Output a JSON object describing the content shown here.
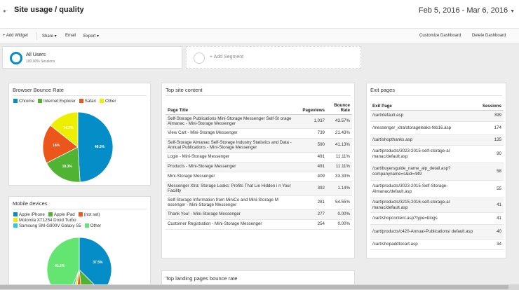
{
  "header": {
    "title": "Site usage / quality",
    "date_range": "Feb 5, 2016 - Mar 6, 2016"
  },
  "toolbar": {
    "add_widget": "+ Add Widget",
    "share": "Share ▾",
    "email": "Email",
    "export": "Export ▾",
    "customize": "Customize Dashboard",
    "delete": "Delete Dashboard"
  },
  "segments": {
    "active": {
      "name": "All Users",
      "sub": "100.00% Sessions"
    },
    "add_label": "+ Add Segment"
  },
  "colors": {
    "chrome": "#058dc7",
    "ie": "#50b432",
    "safari": "#ed561b",
    "other": "#edef00",
    "iphone": "#058dc7",
    "ipad": "#50b432",
    "notset": "#ed561b",
    "motorola": "#edef00",
    "samsung": "#24cbe5",
    "mobile_other": "#64e572"
  },
  "browser": {
    "title": "Browser Bounce Rate",
    "legend": [
      "Chrome",
      "Internet Explorer",
      "Safari",
      "Other"
    ]
  },
  "mobile": {
    "title": "Mobile devices",
    "legend": [
      "Apple iPhone",
      "Apple iPad",
      "(not set)",
      "Motorola XT1254 Droid Turbo",
      "Samsung SM-G900V Galaxy S5",
      "Other"
    ]
  },
  "chart_data": [
    {
      "type": "pie",
      "title": "Browser Bounce Rate",
      "categories": [
        "Chrome",
        "Internet Explorer",
        "Safari",
        "Other"
      ],
      "values": [
        48.5,
        18.3,
        18.0,
        14.2
      ],
      "labels": [
        "48.5%",
        "18.3%",
        "18%",
        "14.2%"
      ]
    },
    {
      "type": "pie",
      "title": "Mobile devices",
      "categories": [
        "Apple iPhone",
        "Apple iPad",
        "(not set)",
        "Motorola XT1254 Droid Turbo",
        "Samsung SM-G900V Galaxy S5",
        "Other"
      ],
      "values": [
        37.5,
        11.0,
        3.5,
        2.5,
        2.0,
        43.5
      ],
      "labels": [
        "37.5%",
        "",
        "",
        "",
        "",
        "43.5%"
      ]
    }
  ],
  "top_content": {
    "title": "Top site content",
    "headers": [
      "Page Title",
      "Pageviews",
      "Bounce Rate"
    ],
    "rows": [
      [
        "Self-Storage Publications Mini-Storage Messenger Self-St orage Almanac - Mini-Storage Messenger",
        "1,037",
        "43.57%"
      ],
      [
        "View Cart - Mini-Storage Messenger",
        "739",
        "21.43%"
      ],
      [
        "Self-Storage Almanac Self-Storage Industry Statistics and Data - Annual Publications - Mini-Storage Messenger",
        "590",
        "41.13%"
      ],
      [
        "Login - Mini-Storage Messenger",
        "491",
        "11.11%"
      ],
      [
        "Products - Mini-Storage Messenger",
        "491",
        "11.11%"
      ],
      [
        "Mini-Storage Messenger",
        "409",
        "33.33%"
      ],
      [
        "Messenger Xtra: Storage Leaks: Profits That Lie Hidden i n Your Facility",
        "392",
        "1.14%"
      ],
      [
        "Self-Storage Information from MiniCo and Mini-Storage M essenger - Mini-Storage Messenger",
        "281",
        "54.55%"
      ],
      [
        "Thank You! - Mini-Storage Messenger",
        "277",
        "0.00%"
      ],
      [
        "Customer Registration - Mini-Storage Messenger",
        "254",
        "0.00%"
      ]
    ]
  },
  "landing": {
    "title": "Top landing pages bounce rate"
  },
  "exit_pages": {
    "title": "Exit pages",
    "headers": [
      "Exit Page",
      "Sessions"
    ],
    "rows": [
      [
        "/cart/default.asp",
        "399"
      ],
      [
        "/messenger_xtra/storageleaks-feb16.asp",
        "174"
      ],
      [
        "/cart/shopthanks.asp",
        "135"
      ],
      [
        "/cart/products/3023-2015-self-storage-al manac/default.asp",
        "90"
      ],
      [
        "/cart/buyersguide_name_alp_detail.asp? companyname=s&id=449",
        "58"
      ],
      [
        "/cart/products/3023-2015-Self-Storage-Almanac/default.asp",
        "55"
      ],
      [
        "/cart/products/3215-2016-self-storage-al manac/default.asp",
        "41"
      ],
      [
        "/cart/shopcontent.asp?type=blogs",
        "41"
      ],
      [
        "/cart/products/c420-Annual-Publications/ default.asp",
        "40"
      ],
      [
        "/cart/shopaddtocart.asp",
        "34"
      ]
    ]
  }
}
